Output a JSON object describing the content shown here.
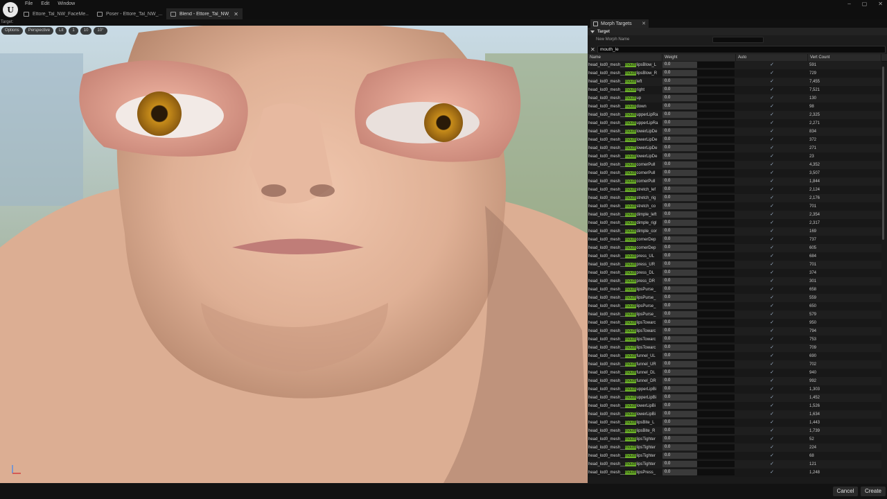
{
  "menu": [
    "File",
    "Edit",
    "Window"
  ],
  "tabs": [
    {
      "label": "Ettore_Tal_NW_FaceMe...",
      "active": false
    },
    {
      "label": "Poser - Ettore_Tal_NW_...",
      "active": false
    },
    {
      "label": "Blend - Ettore_Tal_NW_...",
      "active": true
    }
  ],
  "window_controls": [
    "–",
    "▢",
    "✕"
  ],
  "viewport": {
    "label": "Target:",
    "toolbar": [
      "Options",
      "Perspective",
      "Lit",
      "1",
      "10",
      "10°"
    ]
  },
  "panel": {
    "tab_label": "Morph Targets",
    "section_label": "Target",
    "new_morph_label": "New Morph Name",
    "search_value": "mouth_le",
    "columns": {
      "name": "Name",
      "weight": "Weight",
      "auto": "Auto",
      "vert": "Vert Count"
    },
    "rows": [
      {
        "pre": "head_lod0_mesh__",
        "hl": "mouth",
        "post": "lipsBlow_L",
        "weight": "0.0",
        "vert": "591"
      },
      {
        "pre": "head_lod0_mesh__",
        "hl": "mouth",
        "post": "lipsBlow_R",
        "weight": "0.0",
        "vert": "729"
      },
      {
        "pre": "head_lod0_mesh__",
        "hl": "mouth",
        "post": "left",
        "weight": "0.0",
        "vert": "7,455"
      },
      {
        "pre": "head_lod0_mesh__",
        "hl": "mouth",
        "post": "right",
        "weight": "0.0",
        "vert": "7,521"
      },
      {
        "pre": "head_lod0_mesh__",
        "hl": "mouth",
        "post": "up",
        "weight": "0.0",
        "vert": "130"
      },
      {
        "pre": "head_lod0_mesh__",
        "hl": "mouth",
        "post": "down",
        "weight": "0.0",
        "vert": "98"
      },
      {
        "pre": "head_lod0_mesh__",
        "hl": "mouth",
        "post": "upperLipRa",
        "weight": "0.0",
        "vert": "2,325"
      },
      {
        "pre": "head_lod0_mesh__",
        "hl": "mouth",
        "post": "upperLipRa",
        "weight": "0.0",
        "vert": "2,271"
      },
      {
        "pre": "head_lod0_mesh__",
        "hl": "mouth",
        "post": "lowerLipDe",
        "weight": "0.0",
        "vert": "834"
      },
      {
        "pre": "head_lod0_mesh__",
        "hl": "mouth",
        "post": "lowerLipDe",
        "weight": "0.0",
        "vert": "372"
      },
      {
        "pre": "head_lod0_mesh__",
        "hl": "mouth",
        "post": "lowerLipDe",
        "weight": "0.0",
        "vert": "271"
      },
      {
        "pre": "head_lod0_mesh__",
        "hl": "mouth",
        "post": "lowerLipDe",
        "weight": "0.0",
        "vert": "23"
      },
      {
        "pre": "head_lod0_mesh__",
        "hl": "mouth",
        "post": "cornerPull",
        "weight": "0.0",
        "vert": "4,352"
      },
      {
        "pre": "head_lod0_mesh__",
        "hl": "mouth",
        "post": "cornerPull",
        "weight": "0.0",
        "vert": "3,507"
      },
      {
        "pre": "head_lod0_mesh__",
        "hl": "mouth",
        "post": "cornerPull",
        "weight": "0.0",
        "vert": "1,844"
      },
      {
        "pre": "head_lod0_mesh__",
        "hl": "mouth",
        "post": "stretch_lef",
        "weight": "0.0",
        "vert": "2,124"
      },
      {
        "pre": "head_lod0_mesh__",
        "hl": "mouth",
        "post": "stretch_rig",
        "weight": "0.0",
        "vert": "2,176"
      },
      {
        "pre": "head_lod0_mesh__",
        "hl": "mouth",
        "post": "stretch_co",
        "weight": "0.0",
        "vert": "701"
      },
      {
        "pre": "head_lod0_mesh__",
        "hl": "mouth",
        "post": "dimple_left",
        "weight": "0.0",
        "vert": "2,354"
      },
      {
        "pre": "head_lod0_mesh__",
        "hl": "mouth",
        "post": "dimple_rigl",
        "weight": "0.0",
        "vert": "2,317"
      },
      {
        "pre": "head_lod0_mesh__",
        "hl": "mouth",
        "post": "dimple_cor",
        "weight": "0.0",
        "vert": "169"
      },
      {
        "pre": "head_lod0_mesh__",
        "hl": "mouth",
        "post": "cornerDep",
        "weight": "0.0",
        "vert": "737"
      },
      {
        "pre": "head_lod0_mesh__",
        "hl": "mouth",
        "post": "cornerDep",
        "weight": "0.0",
        "vert": "605"
      },
      {
        "pre": "head_lod0_mesh__",
        "hl": "mouth",
        "post": "press_UL",
        "weight": "0.0",
        "vert": "684"
      },
      {
        "pre": "head_lod0_mesh__",
        "hl": "mouth",
        "post": "press_UR",
        "weight": "0.0",
        "vert": "701"
      },
      {
        "pre": "head_lod0_mesh__",
        "hl": "mouth",
        "post": "press_DL",
        "weight": "0.0",
        "vert": "374"
      },
      {
        "pre": "head_lod0_mesh__",
        "hl": "mouth",
        "post": "press_DR",
        "weight": "0.0",
        "vert": "301"
      },
      {
        "pre": "head_lod0_mesh__",
        "hl": "mouth",
        "post": "lipsPurse_",
        "weight": "0.0",
        "vert": "658"
      },
      {
        "pre": "head_lod0_mesh__",
        "hl": "mouth",
        "post": "lipsPurse_",
        "weight": "0.0",
        "vert": "559"
      },
      {
        "pre": "head_lod0_mesh__",
        "hl": "mouth",
        "post": "lipsPurse_",
        "weight": "0.0",
        "vert": "650"
      },
      {
        "pre": "head_lod0_mesh__",
        "hl": "mouth",
        "post": "lipsPurse_",
        "weight": "0.0",
        "vert": "579"
      },
      {
        "pre": "head_lod0_mesh__",
        "hl": "mouth",
        "post": "lipsTowarc",
        "weight": "0.0",
        "vert": "950"
      },
      {
        "pre": "head_lod0_mesh__",
        "hl": "mouth",
        "post": "lipsTowarc",
        "weight": "0.0",
        "vert": "794"
      },
      {
        "pre": "head_lod0_mesh__",
        "hl": "mouth",
        "post": "lipsTowarc",
        "weight": "0.0",
        "vert": "753"
      },
      {
        "pre": "head_lod0_mesh__",
        "hl": "mouth",
        "post": "lipsTowarc",
        "weight": "0.0",
        "vert": "709"
      },
      {
        "pre": "head_lod0_mesh__",
        "hl": "mouth",
        "post": "funnel_UL",
        "weight": "0.0",
        "vert": "690"
      },
      {
        "pre": "head_lod0_mesh__",
        "hl": "mouth",
        "post": "funnel_UR",
        "weight": "0.0",
        "vert": "702"
      },
      {
        "pre": "head_lod0_mesh__",
        "hl": "mouth",
        "post": "funnel_DL",
        "weight": "0.0",
        "vert": "940"
      },
      {
        "pre": "head_lod0_mesh__",
        "hl": "mouth",
        "post": "funnel_DR",
        "weight": "0.0",
        "vert": "992"
      },
      {
        "pre": "head_lod0_mesh__",
        "hl": "mouth",
        "post": "upperLipBi",
        "weight": "0.0",
        "vert": "1,303"
      },
      {
        "pre": "head_lod0_mesh__",
        "hl": "mouth",
        "post": "upperLipBi",
        "weight": "0.0",
        "vert": "1,452"
      },
      {
        "pre": "head_lod0_mesh__",
        "hl": "mouth",
        "post": "lowerLipBi",
        "weight": "0.0",
        "vert": "1,526"
      },
      {
        "pre": "head_lod0_mesh__",
        "hl": "mouth",
        "post": "lowerLipBi",
        "weight": "0.0",
        "vert": "1,634"
      },
      {
        "pre": "head_lod0_mesh__",
        "hl": "mouth",
        "post": "lipsBite_L",
        "weight": "0.0",
        "vert": "1,443"
      },
      {
        "pre": "head_lod0_mesh__",
        "hl": "mouth",
        "post": "lipsBite_R",
        "weight": "0.0",
        "vert": "1,739"
      },
      {
        "pre": "head_lod0_mesh__",
        "hl": "mouth",
        "post": "lipsTighter",
        "weight": "0.0",
        "vert": "52"
      },
      {
        "pre": "head_lod0_mesh__",
        "hl": "mouth",
        "post": "lipsTighter",
        "weight": "0.0",
        "vert": "224"
      },
      {
        "pre": "head_lod0_mesh__",
        "hl": "mouth",
        "post": "lipsTighter",
        "weight": "0.0",
        "vert": "68"
      },
      {
        "pre": "head_lod0_mesh__",
        "hl": "mouth",
        "post": "lipsTighter",
        "weight": "0.0",
        "vert": "121"
      },
      {
        "pre": "head_lod0_mesh__",
        "hl": "mouth",
        "post": "lipsPress_",
        "weight": "0.0",
        "vert": "1,248"
      }
    ]
  },
  "buttons": {
    "cancel": "Cancel",
    "create": "Create"
  },
  "colors": {
    "highlight": "#6db32a",
    "panel_bg": "#1a1a1a",
    "skin": "#e0b69a"
  }
}
